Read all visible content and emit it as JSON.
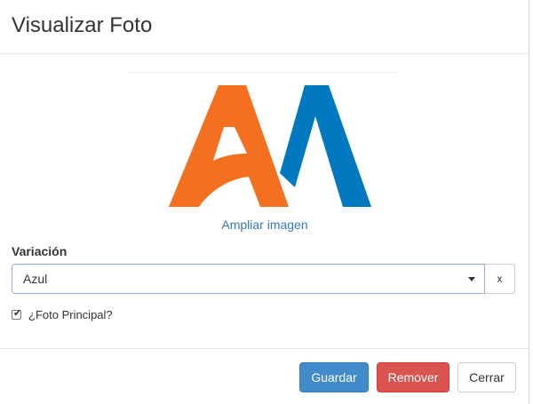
{
  "modal": {
    "title": "Visualizar Foto"
  },
  "image": {
    "logo_icon": "aa-logo-icon",
    "colors": {
      "orange": "#f37021",
      "blue": "#0079c1"
    },
    "enlarge_link": "Ampliar imagen"
  },
  "variation": {
    "label": "Variación",
    "selected": "Azul",
    "clear_label": "x"
  },
  "main_photo": {
    "label": "¿Foto Principal?",
    "checked": true
  },
  "footer": {
    "save_label": "Guardar",
    "remove_label": "Remover",
    "close_label": "Cerrar"
  },
  "colors": {
    "primary": "#428bca",
    "danger": "#d9534f",
    "link": "#337ab7"
  }
}
